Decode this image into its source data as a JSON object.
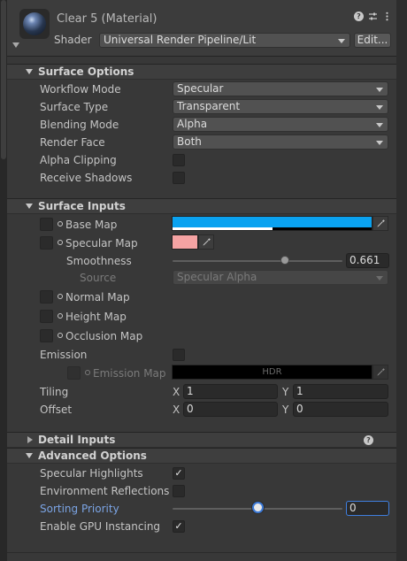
{
  "header": {
    "title": "Clear 5 (Material)",
    "shader_label": "Shader",
    "shader_value": "Universal Render Pipeline/Lit",
    "edit_label": "Edit...",
    "icons": [
      "help-icon",
      "preset-icon",
      "kebab-menu-icon"
    ]
  },
  "surface_options": {
    "title": "Surface Options",
    "rows": [
      {
        "label": "Workflow Mode",
        "value": "Specular"
      },
      {
        "label": "Surface Type",
        "value": "Transparent"
      },
      {
        "label": "Blending Mode",
        "value": "Alpha"
      },
      {
        "label": "Render Face",
        "value": "Both"
      }
    ],
    "alpha_clipping": {
      "label": "Alpha Clipping",
      "checked": false
    },
    "receive_shadows": {
      "label": "Receive Shadows",
      "checked": false
    }
  },
  "surface_inputs": {
    "title": "Surface Inputs",
    "base_map": {
      "label": "Base Map",
      "color": "#0aa2f0",
      "alpha": 0.5
    },
    "specular_map": {
      "label": "Specular Map",
      "color": "#f5a3a3"
    },
    "smoothness": {
      "label": "Smoothness",
      "value": "0.661",
      "fraction": 0.661
    },
    "source": {
      "label": "Source",
      "value": "Specular Alpha"
    },
    "normal_map": {
      "label": "Normal Map"
    },
    "height_map": {
      "label": "Height Map"
    },
    "occlusion_map": {
      "label": "Occlusion Map"
    },
    "emission": {
      "label": "Emission",
      "checked": false
    },
    "emission_map": {
      "label": "Emission Map",
      "hdr_label": "HDR"
    },
    "tiling": {
      "label": "Tiling",
      "x_label": "X",
      "x": "1",
      "y_label": "Y",
      "y": "1"
    },
    "offset": {
      "label": "Offset",
      "x_label": "X",
      "x": "0",
      "y_label": "Y",
      "y": "0"
    }
  },
  "detail_inputs": {
    "title": "Detail Inputs"
  },
  "advanced_options": {
    "title": "Advanced Options",
    "specular_highlights": {
      "label": "Specular Highlights",
      "checked": true,
      "mark": "✓"
    },
    "environment_reflections": {
      "label": "Environment Reflections",
      "checked": false
    },
    "sorting_priority": {
      "label": "Sorting Priority",
      "value": "0",
      "fraction": 0.5
    },
    "gpu_instancing": {
      "label": "Enable GPU Instancing",
      "checked": true,
      "mark": "✓"
    }
  },
  "colors": {
    "panel": "#383838",
    "section": "#3e3e3e",
    "accent": "#3d7ad6",
    "label_highlight": "#7ba4e4"
  }
}
